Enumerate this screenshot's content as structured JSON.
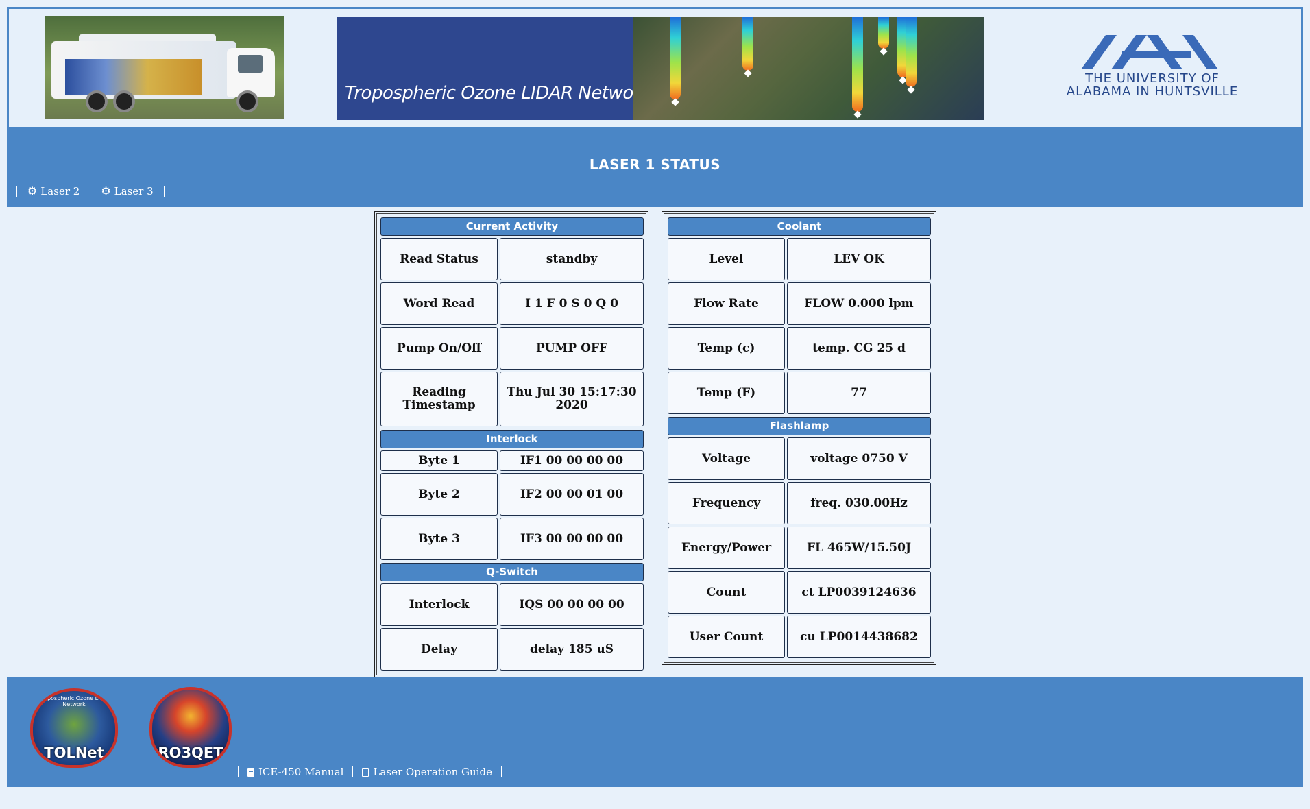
{
  "header": {
    "network_title": "Tropospheric Ozone LIDAR Network",
    "university_name_line1": "THE UNIVERSITY OF",
    "university_name_line2": "ALABAMA IN HUNTSVILLE"
  },
  "page_title": "LASER 1 STATUS",
  "nav": {
    "links": [
      "Laser 2",
      "Laser 3"
    ]
  },
  "current_activity": {
    "title": "Current Activity",
    "rows": [
      {
        "label": "Read Status",
        "value": "standby"
      },
      {
        "label": "Word Read",
        "value": "I 1 F 0 S 0 Q 0"
      },
      {
        "label": "Pump On/Off",
        "value": "PUMP OFF"
      },
      {
        "label": "Reading Timestamp",
        "value": "Thu Jul 30 15:17:30 2020"
      }
    ]
  },
  "interlock": {
    "title": "Interlock",
    "rows": [
      {
        "label": "Byte 1",
        "value": "IF1 00 00 00 00"
      },
      {
        "label": "Byte 2",
        "value": "IF2 00 00 01 00"
      },
      {
        "label": "Byte 3",
        "value": "IF3 00 00 00 00"
      }
    ]
  },
  "qswitch": {
    "title": "Q-Switch",
    "rows": [
      {
        "label": "Interlock",
        "value": "IQS 00 00 00 00"
      },
      {
        "label": "Delay",
        "value": "delay 185 uS"
      }
    ]
  },
  "coolant": {
    "title": "Coolant",
    "rows": [
      {
        "label": "Level",
        "value": "LEV OK"
      },
      {
        "label": "Flow Rate",
        "value": "FLOW 0.000 lpm"
      },
      {
        "label": "Temp (c)",
        "value": "temp. CG 25 d"
      },
      {
        "label": "Temp (F)",
        "value": "77"
      }
    ]
  },
  "flashlamp": {
    "title": "Flashlamp",
    "rows": [
      {
        "label": "Voltage",
        "value": "voltage 0750 V"
      },
      {
        "label": "Frequency",
        "value": "freq. 030.00Hz"
      },
      {
        "label": "Energy/Power",
        "value": "FL 465W/15.50J"
      },
      {
        "label": "Count",
        "value": "ct LP0039124636"
      },
      {
        "label": "User Count",
        "value": "cu LP0014438682"
      }
    ]
  },
  "footer": {
    "tolnet_label": "TOLNet",
    "tolnet_ring": "Tropospheric Ozone Lidar Network",
    "ro3qet_label": "RO3QET",
    "links": [
      "ICE-450 Manual",
      "Laser Operation Guide"
    ]
  },
  "colors": {
    "accent_blue": "#4a86c6",
    "page_background": "#e8f1fa",
    "banner_navy": "#2e478f"
  },
  "icons": {
    "nav": "gear-icon",
    "manual": "book-icon",
    "guide": "pdf-file-icon"
  }
}
